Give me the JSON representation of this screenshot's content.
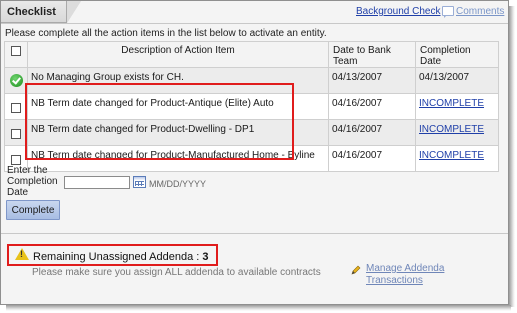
{
  "header": {
    "tab_title": "Checklist",
    "background_check_link": "Background Check",
    "comments_link": "Comments",
    "comment_icon": "comment-bubble-icon"
  },
  "instructions": "Please complete all the action items in the list below to activate an entity.",
  "table": {
    "columns": [
      "Description of Action Item",
      "Date to Bank Team",
      "Completion Date"
    ],
    "rows": [
      {
        "status_icon": "green-check-icon",
        "description": "No Managing Group exists for CH.",
        "date_to_bank": "04/13/2007",
        "completion": "04/13/2007",
        "completion_is_link": false
      },
      {
        "status_icon": "checkbox",
        "description": "NB Term date changed for Product-Antique (Elite) Auto",
        "date_to_bank": "04/16/2007",
        "completion": "INCOMPLETE",
        "completion_is_link": true
      },
      {
        "status_icon": "checkbox",
        "description": "NB Term date changed for Product-Dwelling - DP1",
        "date_to_bank": "04/16/2007",
        "completion": "INCOMPLETE",
        "completion_is_link": true
      },
      {
        "status_icon": "checkbox",
        "description": "NB Term date changed for Product-Manufactured Home - Byline",
        "date_to_bank": "04/16/2007",
        "completion": "INCOMPLETE",
        "completion_is_link": true
      }
    ]
  },
  "completion_form": {
    "label": "Enter the Completion Date",
    "date_value": "",
    "date_format": "MM/DD/YYYY",
    "calendar_icon": "calendar-icon",
    "submit_label": "Complete"
  },
  "addenda": {
    "remaining_label": "Remaining Unassigned Addenda : ",
    "remaining_count": "3",
    "note": "Please make sure you assign ALL addenda to available contracts",
    "manage_link": "Manage Addenda Transactions",
    "warning_icon": "warning-icon",
    "pencil_icon": "pencil-icon"
  },
  "colors": {
    "highlight": "#e01c1c",
    "link": "#1f3fa8",
    "button": "#b6c8ea"
  }
}
